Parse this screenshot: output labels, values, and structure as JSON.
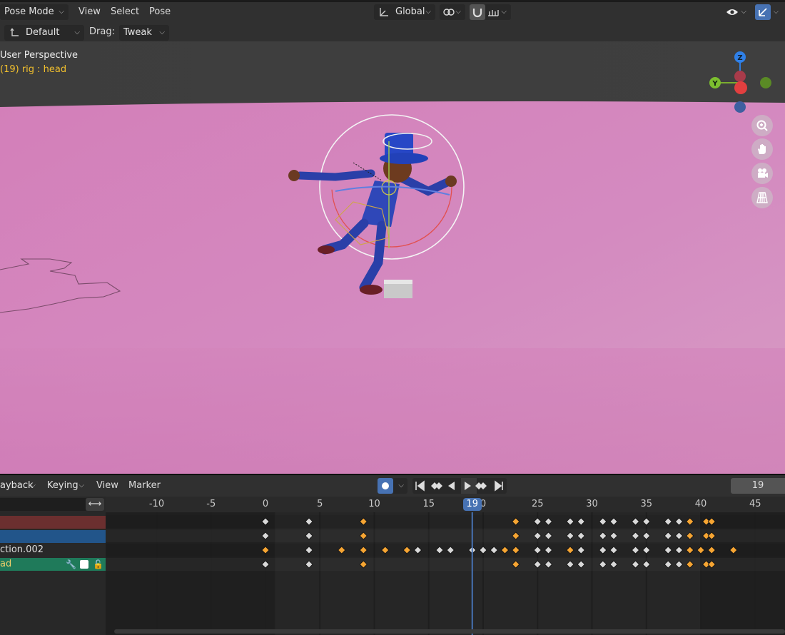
{
  "header": {
    "mode_label": "Pose Mode",
    "menus": [
      "View",
      "Select",
      "Pose"
    ],
    "orientation_label": "Global"
  },
  "tool_header": {
    "pivot_label": "Default",
    "drag_label": "Drag:",
    "drag_value": "Tweak"
  },
  "viewport": {
    "view_name": "User Perspective",
    "object_info": "(19) rig : head",
    "gizmo_axes": {
      "z": "Z",
      "y": "Y"
    },
    "nav_icons": [
      "zoom-icon",
      "hand-pan-icon",
      "camera-icon",
      "grid-perspective-icon"
    ]
  },
  "timeline": {
    "menus": [
      "ayback",
      "Keying",
      "View",
      "Marker"
    ],
    "current_frame": "19",
    "playhead_label": "19",
    "ruler_ticks": [
      -10,
      -5,
      0,
      5,
      10,
      15,
      20,
      25,
      30,
      35,
      40,
      45
    ],
    "ruler_labels": [
      "-10",
      "-5",
      "0",
      "5",
      "10",
      "15",
      "0",
      "25",
      "30",
      "35",
      "40",
      "45"
    ],
    "channels": [
      {
        "label": "",
        "color": "#6b2f2f"
      },
      {
        "label": "",
        "color": "#22558a"
      },
      {
        "label": "ction.002",
        "color": ""
      },
      {
        "label": "ad",
        "color": "#1f7a5a"
      }
    ],
    "keyframes": [
      {
        "row": 0,
        "frames": [
          0,
          4,
          9,
          23,
          25,
          26,
          28,
          29,
          31,
          32,
          34,
          35,
          37,
          38,
          39,
          40.5,
          41
        ],
        "selected": [
          9,
          23,
          39,
          40.5,
          41
        ]
      },
      {
        "row": 1,
        "frames": [
          0,
          4,
          9,
          23,
          25,
          26,
          28,
          29,
          31,
          32,
          34,
          35,
          37,
          38,
          39,
          40.5,
          41
        ],
        "selected": [
          9,
          23,
          39,
          40.5,
          41
        ]
      },
      {
        "row": 2,
        "frames": [
          0,
          4,
          7,
          9,
          11,
          13,
          14,
          16,
          17,
          19,
          20,
          21,
          22,
          23,
          25,
          26,
          28,
          29,
          31,
          32,
          34,
          35,
          37,
          38,
          39,
          40,
          41,
          43
        ],
        "selected": [
          0,
          7,
          9,
          11,
          13,
          22,
          23,
          28,
          39,
          40,
          41,
          43
        ]
      },
      {
        "row": 3,
        "frames": [
          0,
          4,
          9,
          23,
          25,
          26,
          28,
          29,
          31,
          32,
          34,
          35,
          37,
          38,
          39,
          40.5,
          41
        ],
        "selected": [
          9,
          23,
          39,
          40.5,
          41
        ]
      }
    ]
  },
  "colors": {
    "accent": "#4772b3",
    "key_selected": "#f6a533",
    "key_unselected": "#d9d9d9",
    "info_text": "#f2c02d"
  }
}
